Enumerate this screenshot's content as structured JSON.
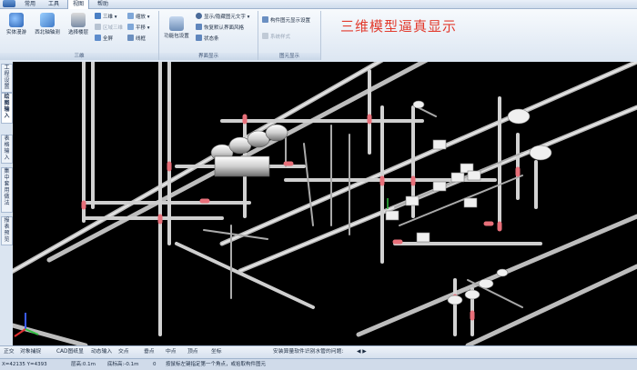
{
  "menu": {
    "items": [
      "常用",
      "工具",
      "视图",
      "帮助"
    ],
    "active": "视图"
  },
  "overlay_title": "三维模型逼真显示",
  "ribbon": {
    "group_view": {
      "label": "三维",
      "big": [
        "实体漫游",
        "西北轴轴测",
        "选择楼层"
      ],
      "small": [
        "三维",
        "区域三维",
        "全屏",
        "缩放",
        "平移",
        "线框"
      ]
    },
    "group_show": {
      "label": "界面显示",
      "small": [
        "显示/隐藏图元文字",
        "恢复默认界面风格",
        "状态条"
      ],
      "big": "功能包设置"
    },
    "group_elem": {
      "label": "图元显示",
      "small": [
        "构件图元显示设置",
        "系统样式"
      ]
    }
  },
  "left_tabs": [
    "工程设置",
    "绘图输入",
    "表格输入",
    "集中套用做法",
    "报表预览"
  ],
  "bottom_bar": [
    "正交",
    "对象捕捉",
    "CAD图纸显",
    "动态输入",
    "交点",
    "垂点",
    "中点",
    "顶点",
    "坐标"
  ],
  "bottom_message": "安装算量软件识别水管的问题:",
  "status": {
    "coords": "X=42135 Y=4393",
    "floor_height": "层高:0.1m",
    "bottom_elev": "底标高:-0.1m",
    "zero": "0",
    "hint": "按鼠标左键指定第一个角点，或拾取构件图元"
  },
  "colors": {
    "accent": "#e23b2e",
    "pipe": "#d9d9d9",
    "joint": "#e8707a"
  }
}
